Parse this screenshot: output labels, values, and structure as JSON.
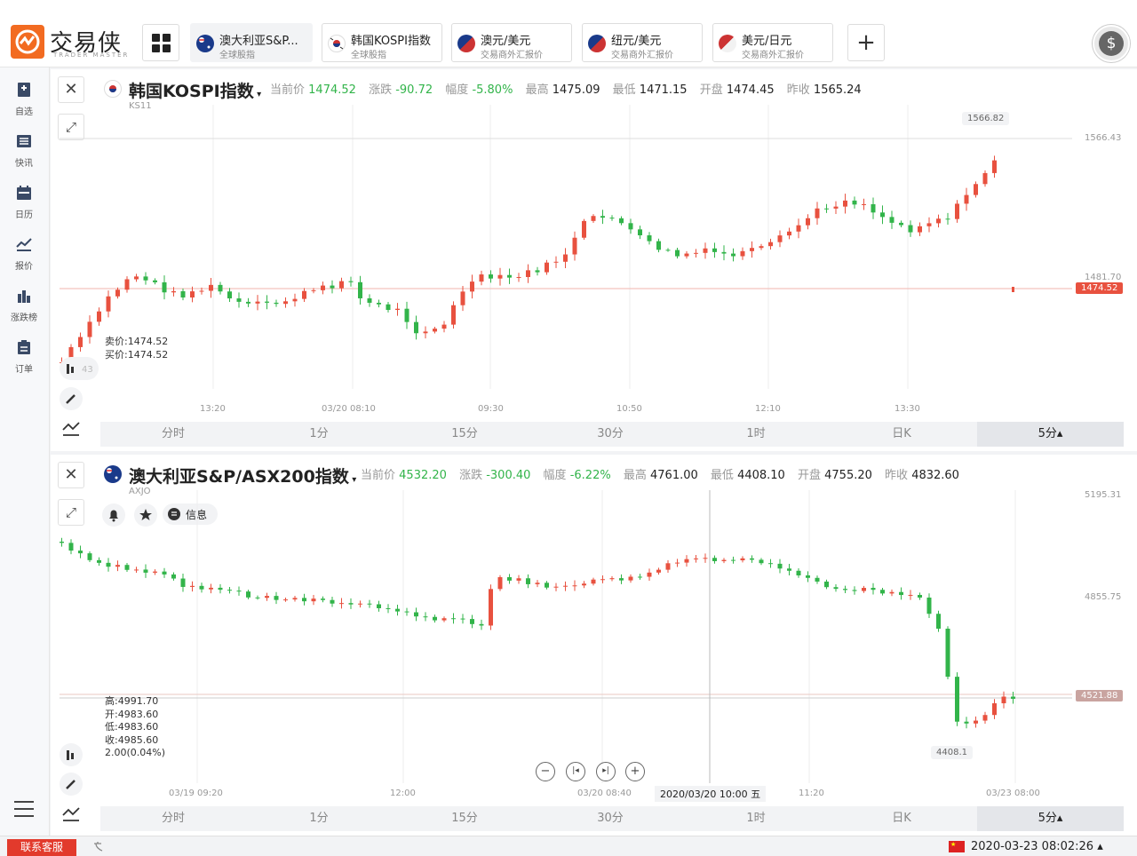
{
  "brand": {
    "name": "交易侠",
    "sub": "TRADER MASTER"
  },
  "tabs": [
    {
      "name": "澳大利亚S&P...",
      "sub": "全球股指"
    },
    {
      "name": "韩国KOSPI指数",
      "sub": "全球股指"
    },
    {
      "name": "澳元/美元",
      "sub": "交易商外汇报价"
    },
    {
      "name": "纽元/美元",
      "sub": "交易商外汇报价"
    },
    {
      "name": "美元/日元",
      "sub": "交易商外汇报价"
    }
  ],
  "sidebar": [
    {
      "label": "自选",
      "icon": "bookmark-icon"
    },
    {
      "label": "快讯",
      "icon": "news-icon"
    },
    {
      "label": "日历",
      "icon": "calendar-icon"
    },
    {
      "label": "报价",
      "icon": "trend-icon"
    },
    {
      "label": "涨跌榜",
      "icon": "bar-chart-icon"
    },
    {
      "label": "订单",
      "icon": "clipboard-icon"
    }
  ],
  "labels": {
    "last": "当前价",
    "change": "涨跌",
    "pct": "幅度",
    "high": "最高",
    "low": "最低",
    "open": "开盘",
    "prev": "昨收"
  },
  "panel1": {
    "title": "韩国KOSPI指数",
    "code": "KS11",
    "last": "1474.52",
    "change": "-90.72",
    "pct": "-5.80%",
    "high": "1475.09",
    "low": "1471.15",
    "open": "1474.45",
    "prev": "1565.24",
    "sell": "卖价:1474.52",
    "buy": "买价:1474.52",
    "partial_left": "43"
  },
  "panel2": {
    "title": "澳大利亚S&P/ASX200指数",
    "code": "AXJO",
    "last": "4532.20",
    "change": "-300.40",
    "pct": "-6.22%",
    "high": "4761.00",
    "low": "4408.10",
    "open": "4755.20",
    "prev": "4832.60",
    "info": "信息",
    "ohlc_high": "高:4991.70",
    "ohlc_open": "开:4983.60",
    "ohlc_low": "低:4983.60",
    "ohlc_close": "收:4985.60",
    "ohlc_chg": "2.00(0.04%)",
    "crosshair_time": "2020/03/20 10:00 五"
  },
  "timeframes": [
    "分时",
    "1分",
    "15分",
    "30分",
    "1时",
    "日K",
    "5分▴"
  ],
  "bottom": {
    "customer_service": "联系客服",
    "timestamp": "2020-03-23 08:02:26 ▴"
  },
  "chart_data": [
    {
      "type": "candlestick",
      "title": "韩国KOSPI指数",
      "x_ticks": [
        "13:20",
        "03/20 08:10",
        "09:30",
        "10:50",
        "12:10",
        "13:30"
      ],
      "y_ticks": [
        "1566.43",
        "1481.70"
      ],
      "peak_label": "1566.82",
      "current_price_label": "1474.52",
      "ylim": [
        1440,
        1580
      ]
    },
    {
      "type": "candlestick",
      "title": "澳大利亚S&P/ASX200指数",
      "x_ticks": [
        "03/19 09:20",
        "12:00",
        "03/20 08:40",
        "11:20",
        "03/23 08:00"
      ],
      "y_ticks": [
        "5195.31",
        "4855.75"
      ],
      "trough_label": "4408.1",
      "current_price_label": "4521.88",
      "ylim": [
        4380,
        5220
      ]
    }
  ],
  "colors": {
    "up": "#e8513f",
    "down": "#32b44a",
    "brand": "#f26b21"
  }
}
